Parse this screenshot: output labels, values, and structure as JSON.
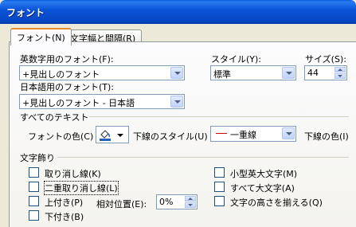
{
  "window": {
    "title": "フォント"
  },
  "tabs": [
    {
      "label": "フォント(N)",
      "active": true
    },
    {
      "label": "文字幅と間隔(R)",
      "active": false
    }
  ],
  "latin_font": {
    "label": "英数字用のフォント(F):",
    "value": "+見出しのフォント"
  },
  "jp_font": {
    "label": "日本語用のフォント(T):",
    "value": "+見出しのフォント - 日本語"
  },
  "style": {
    "label": "スタイル(Y):",
    "value": "標準"
  },
  "size": {
    "label": "サイズ(S):",
    "value": "44"
  },
  "all_text": {
    "heading": "すべてのテキスト",
    "font_color_label": "フォントの色(C)",
    "underline_style_label": "下線のスタイル(U)",
    "underline_style_value": "一重線",
    "underline_color_label": "下線の色(I)"
  },
  "effects": {
    "heading": "文字飾り",
    "strikethrough": "取り消し線(K)",
    "double_strikethrough": "二重取り消し線(L)",
    "superscript": "上付き(P)",
    "subscript": "下付き(B)",
    "offset_label": "相対位置(E):",
    "offset_value": "0%",
    "small_caps": "小型英大文字(M)",
    "all_caps": "すべて大文字(A)",
    "equalize_height": "文字の高さを揃える(Q)"
  },
  "colors": {
    "title_bar": "#0a55d8",
    "tab_highlight": "#e68b2c",
    "underline_sample": "#d40000",
    "font_color_swatch": "#1f5fbf"
  }
}
